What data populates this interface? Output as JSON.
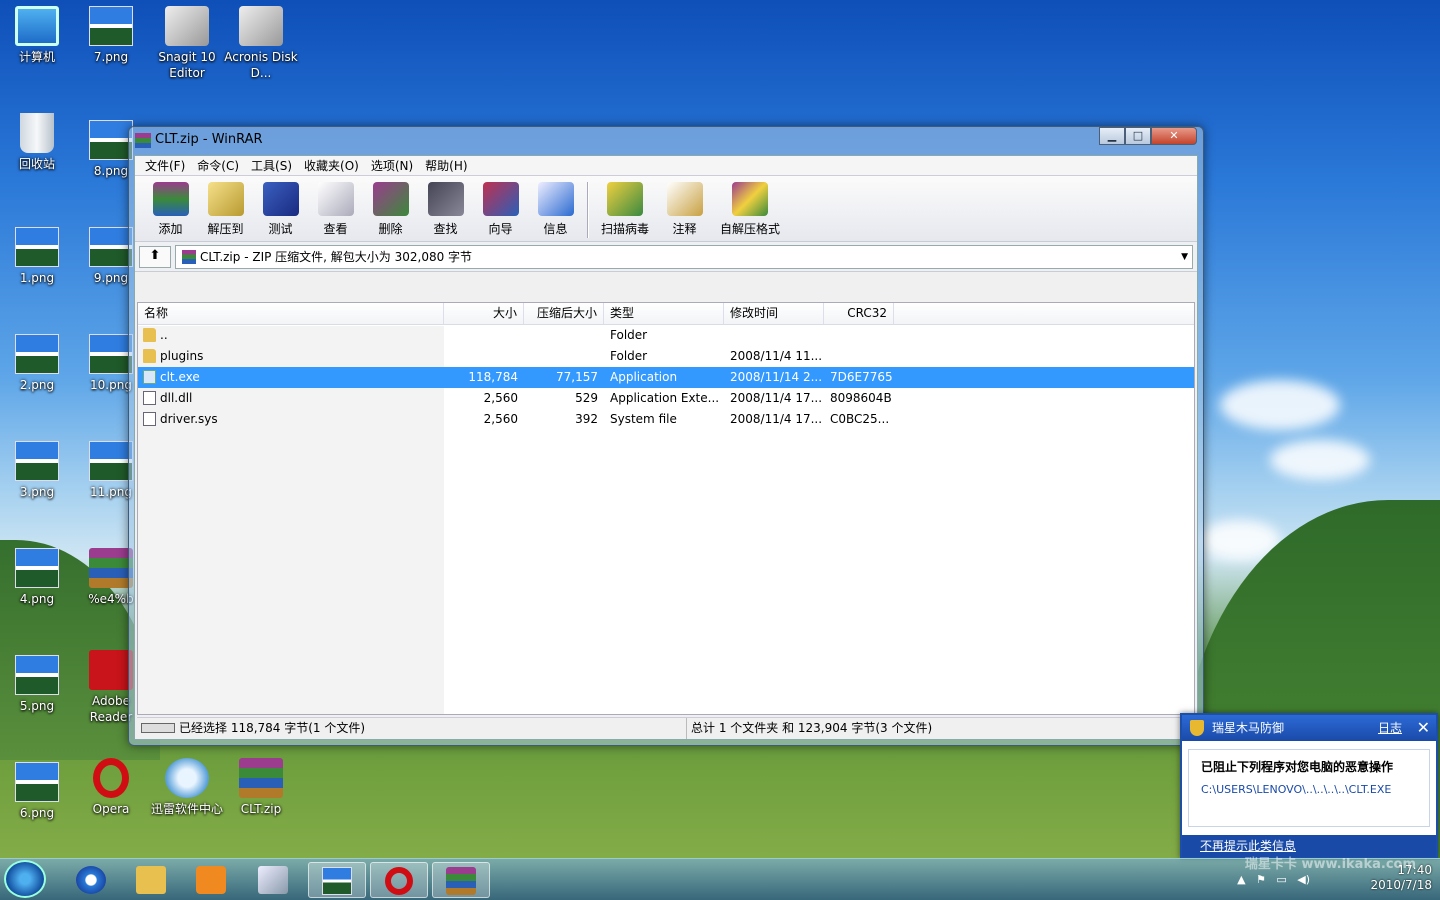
{
  "desktop": {
    "icons": [
      {
        "label": "计算机",
        "kind": "pc"
      },
      {
        "label": "7.png",
        "kind": "png"
      },
      {
        "label": "Snagit 10 Editor",
        "kind": "app"
      },
      {
        "label": "Acronis Disk D...",
        "kind": "app"
      },
      {
        "label": "回收站",
        "kind": "bin"
      },
      {
        "label": "8.png",
        "kind": "png"
      },
      {
        "label": "1.png",
        "kind": "png"
      },
      {
        "label": "9.png",
        "kind": "png"
      },
      {
        "label": "2.png",
        "kind": "png"
      },
      {
        "label": "10.png",
        "kind": "png"
      },
      {
        "label": "3.png",
        "kind": "png"
      },
      {
        "label": "11.png",
        "kind": "png"
      },
      {
        "label": "4.png",
        "kind": "png"
      },
      {
        "label": "%e4%b",
        "kind": "rar"
      },
      {
        "label": "5.png",
        "kind": "png"
      },
      {
        "label": "Adobe Reader",
        "kind": "pdf"
      },
      {
        "label": "6.png",
        "kind": "png"
      },
      {
        "label": "Opera",
        "kind": "opera"
      },
      {
        "label": "迅雷软件中心",
        "kind": "xl"
      },
      {
        "label": "CLT.zip",
        "kind": "rar"
      }
    ]
  },
  "window": {
    "title": "CLT.zip - WinRAR",
    "buttons": {
      "minimize": "▁",
      "maximize": "□",
      "close": "✕"
    },
    "menu": [
      "文件(F)",
      "命令(C)",
      "工具(S)",
      "收藏夹(O)",
      "选项(N)",
      "帮助(H)"
    ],
    "toolbar": [
      "添加",
      "解压到",
      "测试",
      "查看",
      "删除",
      "查找",
      "向导",
      "信息",
      "扫描病毒",
      "注释",
      "自解压格式"
    ],
    "address": "CLT.zip - ZIP 压缩文件, 解包大小为 302,080 字节",
    "columns": [
      "名称",
      "大小",
      "压缩后大小",
      "类型",
      "修改时间",
      "CRC32"
    ],
    "rows": [
      {
        "name": "..",
        "size": "",
        "packed": "",
        "type": "Folder",
        "modified": "",
        "crc": "",
        "icon": "folder"
      },
      {
        "name": "plugins",
        "size": "",
        "packed": "",
        "type": "Folder",
        "modified": "2008/11/4 11...",
        "crc": "",
        "icon": "folder"
      },
      {
        "name": "clt.exe",
        "size": "118,784",
        "packed": "77,157",
        "type": "Application",
        "modified": "2008/11/14 2...",
        "crc": "7D6E7765",
        "icon": "exe",
        "selected": true
      },
      {
        "name": "dll.dll",
        "size": "2,560",
        "packed": "529",
        "type": "Application Exte...",
        "modified": "2008/11/4 17...",
        "crc": "8098604B",
        "icon": "doc"
      },
      {
        "name": "driver.sys",
        "size": "2,560",
        "packed": "392",
        "type": "System file",
        "modified": "2008/11/4 17...",
        "crc": "C0BC25...",
        "icon": "doc"
      }
    ],
    "status_left": "已经选择 118,784 字节(1 个文件)",
    "status_right": "总计 1 个文件夹 和 123,904 字节(3 个文件)"
  },
  "popup": {
    "title": "瑞星木马防御",
    "log": "日志",
    "close": "✕",
    "heading": "已阻止下列程序对您电脑的恶意操作",
    "path": "C:\\USERS\\LENOVO\\..\\..\\..\\..\\CLT.EXE",
    "footer": "不再提示此类信息"
  },
  "taskbar": {
    "time": "17:40",
    "date": "2010/7/18",
    "watermark": "瑞星卡卡 www.ikaka.com"
  }
}
